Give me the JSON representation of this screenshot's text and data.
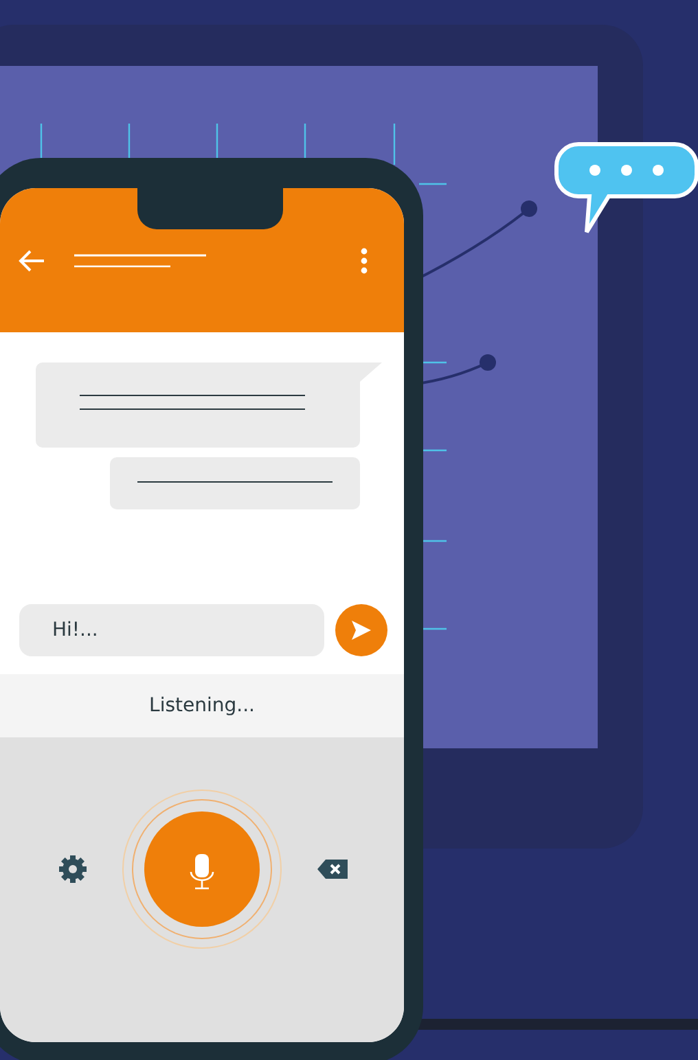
{
  "chat_input": {
    "value": "Hi!..."
  },
  "voice_status": "Listening..."
}
